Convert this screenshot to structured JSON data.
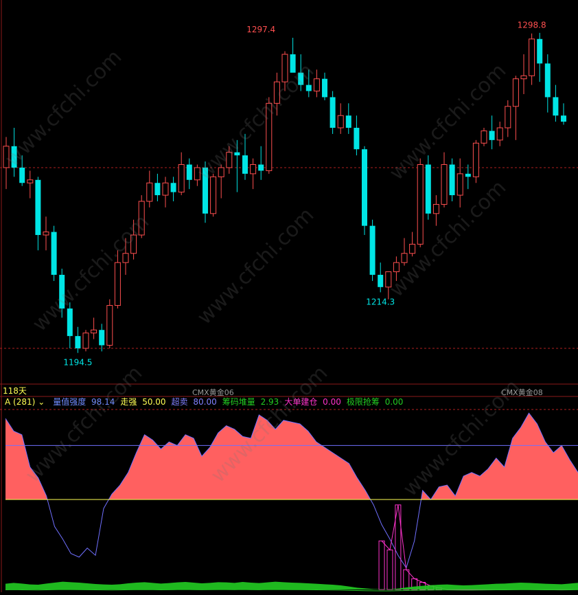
{
  "header": {
    "days_label": "118天",
    "contract_left": "CMX黄金06",
    "contract_right": "CMX黄金08"
  },
  "indicator": {
    "name": "A (281)",
    "dropdown_glyph": "⌄",
    "items": [
      {
        "label": "量值强度",
        "value": "98.14",
        "color": "#6f8cff"
      },
      {
        "label": "走强",
        "value": "50.00",
        "color": "#ffff54"
      },
      {
        "label": "超卖",
        "value": "80.00",
        "color": "#8080ff"
      },
      {
        "label": "筹码堆量",
        "value": "2.93",
        "color": "#22cc22"
      },
      {
        "label": "大单建仓",
        "value": "0.00",
        "color": "#ff33cc"
      },
      {
        "label": "极限抢筹",
        "value": "0.00",
        "color": "#22cc22"
      }
    ]
  },
  "watermark": "www.cfchi.com",
  "colors": {
    "up": "#ff4f4f",
    "down": "#00e5e5",
    "strength_fill": "#ff6060",
    "strength_line": "#7070ff",
    "level_80": "#7070ff",
    "level_50": "#ffff54",
    "accumulation": "#22cc22",
    "big_order": "#ff33cc",
    "grid": "#b02020"
  },
  "chart_data": [
    {
      "type": "candlestick",
      "price_range": [
        1185,
        1303
      ],
      "annotations": [
        {
          "label": "1297.4",
          "index": 32,
          "value": 1297.4,
          "color": "#ff4f4f"
        },
        {
          "label": "1298.8",
          "index": 66,
          "value": 1298.8,
          "color": "#ff4f4f"
        },
        {
          "label": "1214.3",
          "index": 47,
          "value": 1214.3,
          "color": "#00e5e5"
        },
        {
          "label": "1194.5",
          "index": 9,
          "value": 1194.5,
          "color": "#00e5e5"
        }
      ],
      "ohlc": [
        [
          1255,
          1265,
          1248,
          1262
        ],
        [
          1262,
          1268,
          1252,
          1255
        ],
        [
          1255,
          1259,
          1249,
          1250
        ],
        [
          1250,
          1254,
          1245,
          1251
        ],
        [
          1251,
          1252,
          1228,
          1233
        ],
        [
          1233,
          1239,
          1228,
          1234
        ],
        [
          1234,
          1236,
          1218,
          1220
        ],
        [
          1220,
          1222,
          1206,
          1209
        ],
        [
          1209,
          1211,
          1196,
          1200
        ],
        [
          1200,
          1203,
          1194.5,
          1196
        ],
        [
          1196,
          1202,
          1195,
          1201
        ],
        [
          1201,
          1206,
          1199,
          1202
        ],
        [
          1202,
          1204,
          1195,
          1197
        ],
        [
          1197,
          1212,
          1196,
          1210
        ],
        [
          1210,
          1228,
          1209,
          1224
        ],
        [
          1224,
          1232,
          1220,
          1227
        ],
        [
          1227,
          1238,
          1225,
          1233
        ],
        [
          1233,
          1246,
          1232,
          1244
        ],
        [
          1244,
          1254,
          1242,
          1250
        ],
        [
          1250,
          1253,
          1244,
          1246
        ],
        [
          1246,
          1252,
          1242,
          1250
        ],
        [
          1250,
          1252,
          1244,
          1247
        ],
        [
          1247,
          1260,
          1246,
          1256
        ],
        [
          1256,
          1258,
          1248,
          1251
        ],
        [
          1251,
          1256,
          1249,
          1255
        ],
        [
          1255,
          1257,
          1237,
          1240
        ],
        [
          1240,
          1253,
          1239,
          1252
        ],
        [
          1252,
          1256,
          1245,
          1255
        ],
        [
          1255,
          1262,
          1253,
          1260
        ],
        [
          1260,
          1264,
          1247,
          1259
        ],
        [
          1259,
          1266,
          1251,
          1253
        ],
        [
          1253,
          1258,
          1248,
          1256
        ],
        [
          1256,
          1262,
          1251,
          1254
        ],
        [
          1254,
          1278,
          1253,
          1276
        ],
        [
          1276,
          1286,
          1272,
          1283
        ],
        [
          1283,
          1293,
          1280,
          1292
        ],
        [
          1292,
          1297.4,
          1288,
          1286
        ],
        [
          1286,
          1292,
          1280,
          1282
        ],
        [
          1282,
          1287,
          1278,
          1280
        ],
        [
          1280,
          1287,
          1278,
          1284
        ],
        [
          1284,
          1286,
          1277,
          1278
        ],
        [
          1278,
          1280,
          1266,
          1268
        ],
        [
          1268,
          1276,
          1266,
          1272
        ],
        [
          1272,
          1276,
          1266,
          1268
        ],
        [
          1268,
          1272,
          1259,
          1261
        ],
        [
          1261,
          1262,
          1233,
          1236
        ],
        [
          1236,
          1238,
          1218,
          1220
        ],
        [
          1220,
          1224,
          1214.3,
          1216
        ],
        [
          1216,
          1221,
          1212,
          1221
        ],
        [
          1221,
          1226,
          1218,
          1224
        ],
        [
          1224,
          1232,
          1223,
          1227
        ],
        [
          1227,
          1234,
          1226,
          1230
        ],
        [
          1230,
          1258,
          1229,
          1256
        ],
        [
          1256,
          1259,
          1238,
          1240
        ],
        [
          1240,
          1246,
          1236,
          1243
        ],
        [
          1243,
          1260,
          1242,
          1256
        ],
        [
          1256,
          1258,
          1244,
          1246
        ],
        [
          1246,
          1258,
          1242,
          1253
        ],
        [
          1253,
          1256,
          1248,
          1252
        ],
        [
          1252,
          1264,
          1250,
          1263
        ],
        [
          1263,
          1268,
          1262,
          1267
        ],
        [
          1267,
          1272,
          1261,
          1264
        ],
        [
          1264,
          1270,
          1262,
          1268
        ],
        [
          1268,
          1277,
          1265,
          1275
        ],
        [
          1275,
          1285,
          1264,
          1284
        ],
        [
          1284,
          1292,
          1279,
          1285
        ],
        [
          1285,
          1298.8,
          1282,
          1297
        ],
        [
          1297,
          1299,
          1283,
          1289
        ],
        [
          1289,
          1292,
          1273,
          1278
        ],
        [
          1278,
          1282,
          1270,
          1272
        ],
        [
          1272,
          1276,
          1269,
          1270
        ]
      ]
    },
    {
      "type": "area",
      "name": "量值强度",
      "ylim": [
        0,
        100
      ],
      "reference_lines": [
        {
          "label": "超卖",
          "value": 80
        },
        {
          "label": "走强",
          "value": 50
        }
      ],
      "strength": [
        95,
        88,
        86,
        68,
        62,
        52,
        35,
        28,
        20,
        18,
        23,
        19,
        45,
        53,
        58,
        65,
        76,
        86,
        83,
        78,
        82,
        80,
        86,
        84,
        74,
        79,
        87,
        91,
        89,
        85,
        84,
        97,
        94,
        89,
        94,
        93,
        92,
        88,
        82,
        79,
        76,
        73,
        70,
        62,
        55,
        47,
        36,
        28,
        19,
        12,
        27,
        55,
        50,
        57,
        58,
        52,
        63,
        65,
        63,
        67,
        73,
        68,
        84,
        90,
        98,
        92,
        82,
        76,
        80,
        72,
        65
      ]
    },
    {
      "type": "bar",
      "name": "大单建仓",
      "values": [
        0,
        0,
        0,
        0,
        0,
        0,
        0,
        0,
        0,
        0,
        0,
        0,
        0,
        0,
        0,
        0,
        0,
        0,
        0,
        0,
        0,
        0,
        0,
        0,
        0,
        0,
        0,
        0,
        0,
        0,
        0,
        0,
        0,
        0,
        0,
        0,
        0,
        0,
        0,
        0,
        0,
        0,
        0,
        0,
        0,
        0,
        27,
        22,
        47,
        11,
        6,
        4,
        2,
        1,
        0,
        0,
        0,
        0,
        0,
        0,
        0,
        0,
        0,
        0,
        0,
        0,
        0,
        0,
        0,
        0,
        0
      ]
    },
    {
      "type": "area",
      "name": "筹码堆量",
      "values": [
        2.5,
        2.9,
        2.6,
        2.2,
        2.1,
        2.6,
        3.0,
        3.4,
        3.2,
        3.0,
        2.7,
        2.4,
        2.2,
        2.1,
        2.3,
        2.7,
        3.0,
        3.2,
        2.9,
        2.6,
        2.8,
        3.1,
        3.3,
        3.0,
        2.7,
        2.9,
        3.2,
        3.1,
        2.9,
        3.3,
        3.0,
        2.8,
        3.1,
        3.4,
        3.2,
        3.0,
        2.9,
        2.7,
        2.5,
        2.3,
        2.1,
        1.8,
        1.3,
        0.8,
        0.5,
        0.2,
        0.1,
        0.1,
        0.4,
        0.9,
        1.3,
        1.6,
        1.9,
        2.1,
        2.2,
        2.0,
        1.8,
        1.9,
        2.1,
        2.3,
        2.5,
        2.6,
        2.8,
        3.0,
        2.9,
        2.7,
        2.5,
        2.4,
        2.3,
        2.6,
        2.93
      ]
    }
  ]
}
